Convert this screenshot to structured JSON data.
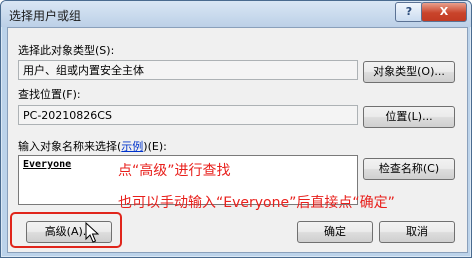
{
  "window": {
    "title": "选择用户或组"
  },
  "titlebar": {
    "help_glyph": "?",
    "close_glyph": "X"
  },
  "object_type": {
    "label": "选择此对象类型(S):",
    "value": "用户、组或内置安全主体",
    "button": "对象类型(O)..."
  },
  "location": {
    "label": "查找位置(F):",
    "value": "PC-20210826CS",
    "button": "位置(L)..."
  },
  "names": {
    "label_prefix": "输入对象名称来选择(",
    "label_link": "示例",
    "label_suffix": ")(E):",
    "value": "Everyone",
    "check_button": "检查名称(C)"
  },
  "annotations": {
    "line1": "点“高级”进行查找",
    "line2": "也可以手动输入“Everyone”后直接点“确定”"
  },
  "buttons": {
    "advanced": "高级(A)...",
    "ok": "确定",
    "cancel": "取消"
  },
  "colors": {
    "annotation": "#e8201c",
    "link": "#0033cc",
    "close": "#c9442b"
  },
  "icons": {
    "cursor": "mouse-pointer-icon"
  }
}
